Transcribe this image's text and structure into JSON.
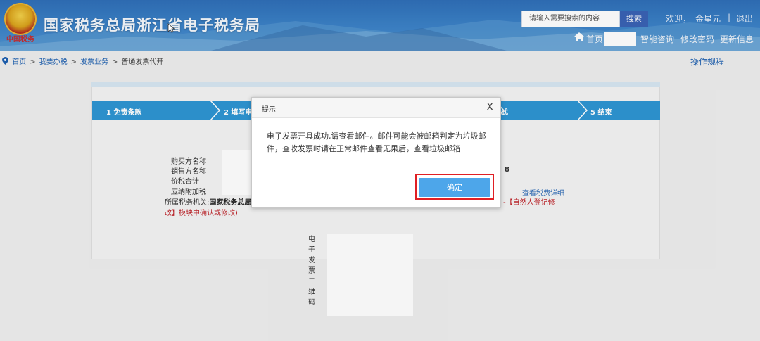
{
  "header": {
    "title": "国家税务总局浙江省电子税务局",
    "emblem_caption": "中国税务",
    "search": {
      "placeholder": "请输入需要搜索的内容",
      "button": "搜索"
    },
    "user": {
      "welcome": "欢迎，",
      "name": "金星元",
      "logout": "退出",
      "separator": "|"
    },
    "nav": {
      "home": "首页",
      "smart_consult": "智能咨询",
      "change_password": "修改密码",
      "update_info": "更新信息"
    }
  },
  "breadcrumb": {
    "items": [
      "首页",
      "我要办税",
      "发票业务",
      "普通发票代开"
    ],
    "separator": ">"
  },
  "ops_link": "操作规程",
  "steps": [
    {
      "label": "1 免责条款"
    },
    {
      "label": "2 填写申"
    },
    {
      "label": "式"
    },
    {
      "label": "5 结束"
    }
  ],
  "info": {
    "labels": [
      "购买方名称",
      "销售方名称",
      "价税合计",
      "应纳附加税"
    ],
    "partial_number": "8",
    "detail_link": "查看税费详细",
    "tax_org_label": "所属税务机关:",
    "tax_org_value": "国家税务总局",
    "note_right": "-【自然人登记修",
    "note_left": "改】模块中确认或修改)"
  },
  "qr": {
    "label_chars": [
      "电",
      "子",
      "发",
      "票",
      "二",
      "维",
      "码"
    ]
  },
  "dialog": {
    "title": "提示",
    "close": "X",
    "message": "电子发票开具成功,请查看邮件。邮件可能会被邮箱判定为垃圾邮件，查收发票时请在正常邮件查看无果后，查看垃圾邮箱",
    "confirm": "确定"
  },
  "colors": {
    "header_blue": "#3d83c8",
    "step_blue": "#2e95d3",
    "confirm_blue": "#4da6ea",
    "highlight_red": "#e01f24",
    "link_blue": "#1d5fb0"
  }
}
